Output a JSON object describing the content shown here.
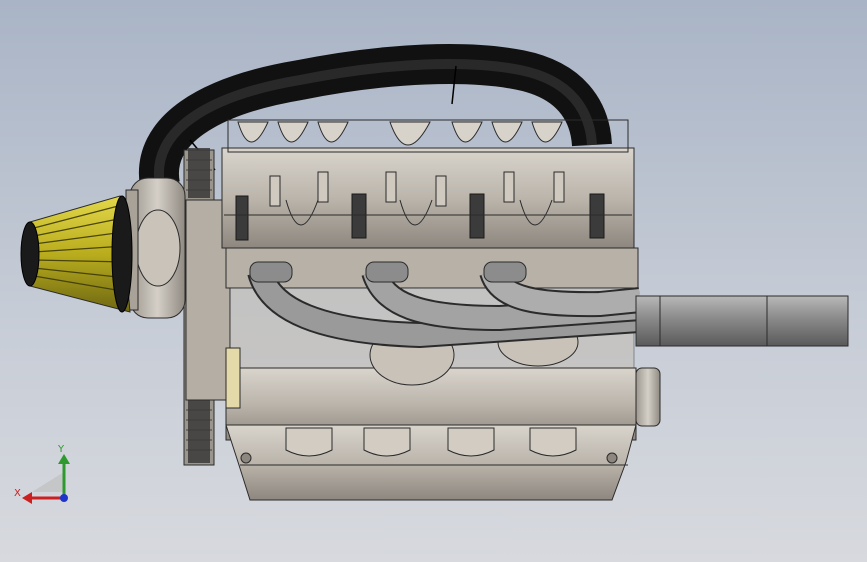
{
  "viewport": {
    "background_top": "#a9b4c6",
    "background_bottom": "#d7d9de"
  },
  "colors": {
    "metal": "#bdb7ae",
    "metal_dark": "#7d776f",
    "hose": "#1d1d1d",
    "air_filter": "#c8bd2a",
    "air_filter_dark": "#6e6712",
    "edge": "#2b2b2b",
    "exhaust_pipe": "#8f8f8f",
    "axis_x": "#cc1f1f",
    "axis_y": "#2e9a2e",
    "axis_z": "#1f34c8"
  },
  "triad": {
    "x_label": "X",
    "y_label": "Y"
  },
  "model": {
    "icon": "engine-3d-model"
  }
}
